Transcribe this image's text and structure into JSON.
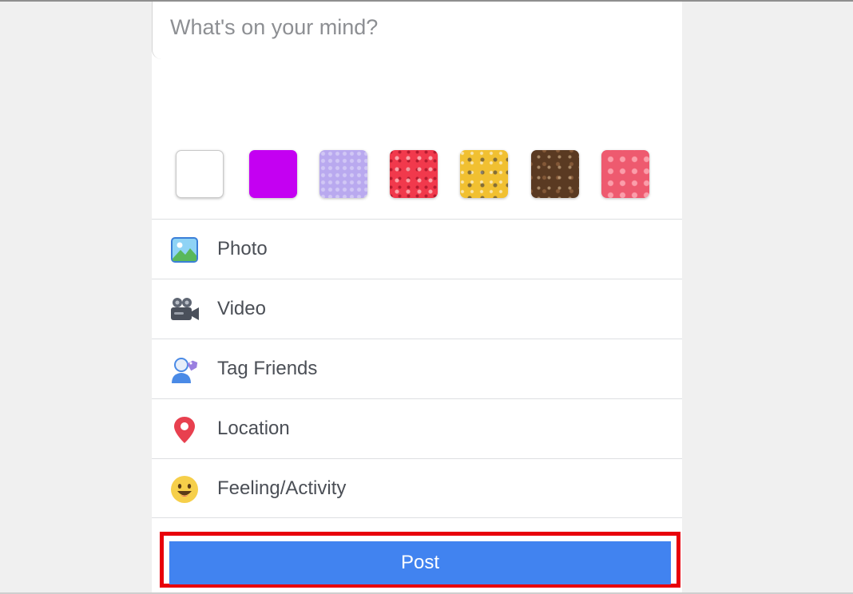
{
  "composer": {
    "placeholder": "What's on your mind?"
  },
  "backgrounds": [
    {
      "name": "white",
      "color": "#ffffff"
    },
    {
      "name": "purple",
      "color": "#c400f2"
    },
    {
      "name": "lavender-pattern",
      "color": "#b9a9ef"
    },
    {
      "name": "red-pattern",
      "color": "#f1394c"
    },
    {
      "name": "yellow-pattern",
      "color": "#f1c031"
    },
    {
      "name": "brown-pattern",
      "color": "#5a3a22"
    },
    {
      "name": "pink-hearts-pattern",
      "color": "#ee5a6f"
    }
  ],
  "menu": {
    "items": [
      {
        "label": "Photo",
        "icon": "photo-icon"
      },
      {
        "label": "Video",
        "icon": "video-camera-icon"
      },
      {
        "label": "Tag Friends",
        "icon": "tag-friends-icon"
      },
      {
        "label": "Location",
        "icon": "location-pin-icon"
      },
      {
        "label": "Feeling/Activity",
        "icon": "smiley-face-icon"
      }
    ]
  },
  "post_button": {
    "label": "Post",
    "color": "#4183f0",
    "highlight_color": "#e8000b"
  }
}
